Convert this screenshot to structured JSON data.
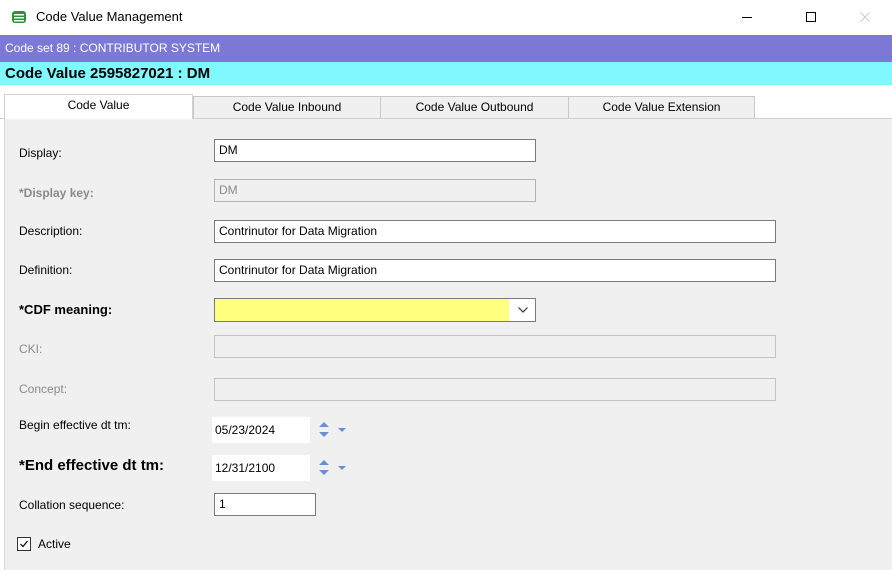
{
  "window": {
    "title": "Code Value Management",
    "icon": "app-grid-icon",
    "controls": [
      "minimize-icon",
      "maximize-icon",
      "close-icon"
    ]
  },
  "banner": {
    "code_set": "Code set 89 : CONTRIBUTOR SYSTEM",
    "code_value": "Code Value 2595827021 : DM"
  },
  "tabs": [
    {
      "label": "Code Value",
      "active": true
    },
    {
      "label": "Code Value Inbound",
      "active": false
    },
    {
      "label": "Code Value Outbound",
      "active": false
    },
    {
      "label": "Code Value Extension",
      "active": false
    }
  ],
  "form": {
    "display": {
      "label": "Display:",
      "value": "DM"
    },
    "display_key": {
      "label": "*Display key:",
      "value": "DM"
    },
    "description": {
      "label": "Description:",
      "value": "Contrinutor for Data Migration"
    },
    "definition": {
      "label": "Definition:",
      "value": "Contrinutor for Data Migration"
    },
    "cdf_meaning": {
      "label": "*CDF meaning:",
      "value": ""
    },
    "cki": {
      "label": "CKI:",
      "value": ""
    },
    "concept": {
      "label": "Concept:",
      "value": ""
    },
    "begin_effective": {
      "label": "Begin effective dt tm:",
      "value": "05/23/2024"
    },
    "end_effective": {
      "label": "*End effective dt tm:",
      "value": "12/31/2100"
    },
    "collation_sequence": {
      "label": "Collation sequence:",
      "value": "1"
    },
    "active": {
      "label": "Active",
      "checked": true
    }
  },
  "colors": {
    "banner_code_set": "#7c79d6",
    "banner_code_value": "#7ff8fe",
    "required_highlight": "#ffff80"
  }
}
